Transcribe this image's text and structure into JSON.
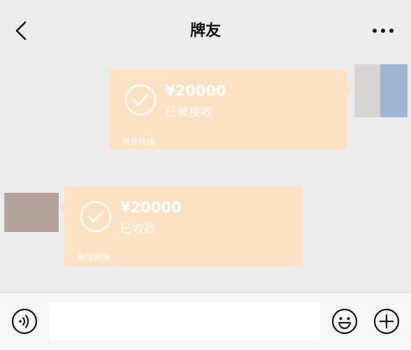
{
  "header": {
    "title": "牌友",
    "back_icon": "chevron-left-icon",
    "more_icon": "ellipsis-icon"
  },
  "messages": [
    {
      "direction": "outgoing",
      "amount": "¥20000",
      "status": "已被接收",
      "footer": "微信转账",
      "icon": "check-circle-icon"
    },
    {
      "direction": "incoming",
      "amount": "¥20000",
      "status": "已收款",
      "footer": "微信转账",
      "icon": "check-circle-icon"
    }
  ],
  "input_bar": {
    "voice_icon": "voice-icon",
    "emoji_icon": "emoji-icon",
    "add_icon": "plus-icon",
    "text_value": ""
  },
  "colors": {
    "background": "#ededed",
    "transfer_bubble": "#fde2c4",
    "outgoing_avatar_left": "#d6d5d1",
    "outgoing_avatar_right": "#9eb6d1",
    "incoming_avatar": "#b5a29b"
  }
}
